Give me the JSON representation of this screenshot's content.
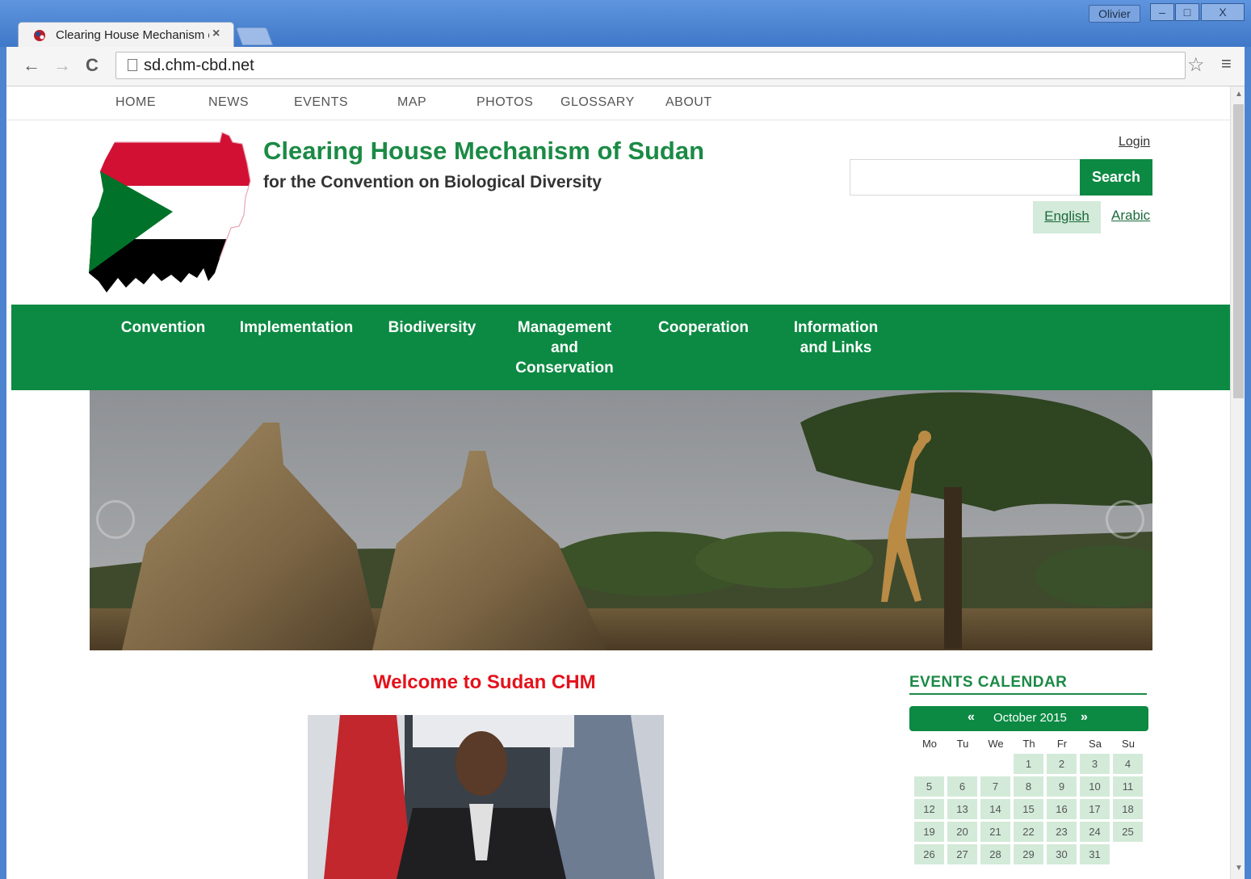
{
  "browser": {
    "tab_title": "Clearing House Mechanism of Sudan",
    "tab_close": "×",
    "user": "Olivier",
    "min": "–",
    "max": "□",
    "close": "X",
    "back": "←",
    "forward": "→",
    "reload": "C",
    "url": "sd.chm-cbd.net",
    "star": "☆",
    "menu": "≡"
  },
  "topnav": [
    "HOME",
    "NEWS",
    "EVENTS",
    "MAP",
    "PHOTOS",
    "GLOSSARY",
    "ABOUT"
  ],
  "header": {
    "title": "Clearing House Mechanism of Sudan",
    "subtitle": "for the Convention on Biological Diversity",
    "login": "Login",
    "search_placeholder": "",
    "search_button": "Search",
    "lang_english": "English",
    "lang_arabic": "Arabic"
  },
  "mainnav": [
    {
      "lines": [
        "Convention"
      ]
    },
    {
      "lines": [
        "Implementation"
      ]
    },
    {
      "lines": [
        "Biodiversity"
      ]
    },
    {
      "lines": [
        "Management",
        "and",
        "Conservation"
      ]
    },
    {
      "lines": [
        "Cooperation"
      ]
    },
    {
      "lines": [
        "Information",
        "and Links"
      ]
    }
  ],
  "welcome": "Welcome to Sudan CHM",
  "events": {
    "heading": "EVENTS CALENDAR",
    "prev": "«",
    "month": "October 2015",
    "next": "»",
    "dow": [
      "Mo",
      "Tu",
      "We",
      "Th",
      "Fr",
      "Sa",
      "Su"
    ],
    "first_weekday": 3,
    "days_in_month": 31
  },
  "colors": {
    "brand_green": "#0c8a43",
    "title_green": "#1b8a45",
    "welcome_red": "#e3121b",
    "calendar_cell": "#d3ead9"
  }
}
